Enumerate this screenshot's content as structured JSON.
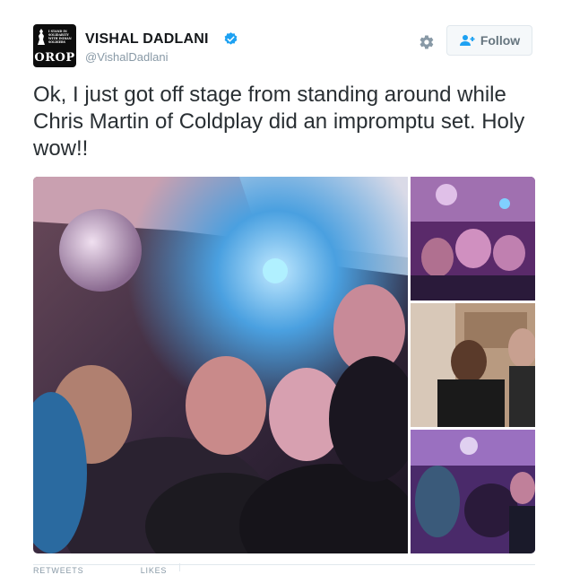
{
  "user": {
    "name": "VISHAL DADLANI",
    "handle": "@VishalDadlani",
    "verified": true,
    "avatar": {
      "text": "OROP",
      "small_text": "I STAND IN SOLIDARITY WITH INDIAN SOLDIERS",
      "background": "#0d0d0d"
    }
  },
  "actions": {
    "settings_icon": "gear-icon",
    "follow_label": "Follow",
    "follow_icon": "follow-user-icon"
  },
  "tweet": {
    "text": "Ok, I just got off stage from standing around while Chris Martin of Coldplay did an impromptu set. Holy wow!!"
  },
  "media": {
    "photo_count": 4,
    "items": [
      {
        "id": "photo-main",
        "description": "group selfie"
      },
      {
        "id": "photo-2",
        "description": "group selfie"
      },
      {
        "id": "photo-3",
        "description": "two men posing"
      },
      {
        "id": "photo-4",
        "description": "crowd with disco ball"
      }
    ]
  },
  "stats": {
    "retweets_label": "RETWEETS",
    "likes_label": "LIKES"
  },
  "colors": {
    "verified": "#1da1f2",
    "text": "#292f33",
    "secondary": "#8899a6",
    "button_bg": "#f5f8fa"
  }
}
